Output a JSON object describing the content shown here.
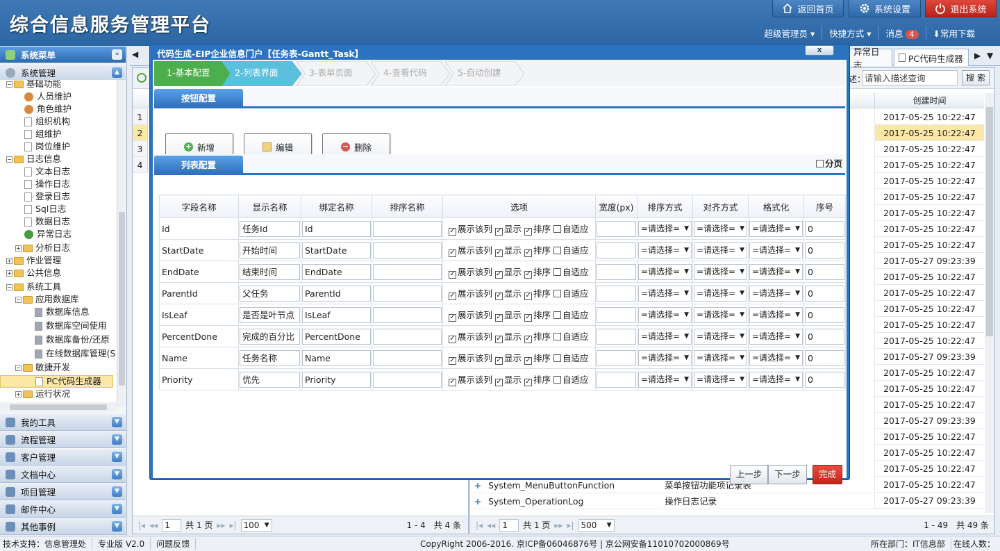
{
  "header": {
    "title": "综合信息服务管理平台",
    "top_buttons": {
      "home": "返回首页",
      "settings": "系统设置",
      "logout": "退出系统"
    },
    "user_bar": {
      "user": "超级管理员",
      "shortcuts": "快捷方式",
      "messages": "消息",
      "message_count": "4",
      "downloads": "常用下载"
    }
  },
  "sidebar": {
    "title": "系统菜单",
    "section": "系统管理",
    "tree": [
      {
        "label": "基础功能",
        "type": "folder"
      },
      {
        "label": "人员维护",
        "type": "user"
      },
      {
        "label": "角色维护",
        "type": "user"
      },
      {
        "label": "组织机构",
        "type": "doc"
      },
      {
        "label": "组维护",
        "type": "doc"
      },
      {
        "label": "岗位维护",
        "type": "doc"
      },
      {
        "label": "日志信息",
        "type": "folder"
      },
      {
        "label": "文本日志",
        "type": "doc"
      },
      {
        "label": "操作日志",
        "type": "doc"
      },
      {
        "label": "登录日志",
        "type": "doc"
      },
      {
        "label": "Sql日志",
        "type": "doc"
      },
      {
        "label": "数据日志",
        "type": "doc"
      },
      {
        "label": "异常日志",
        "type": "bug"
      },
      {
        "label": "分析日志",
        "type": "folder"
      },
      {
        "label": "作业管理",
        "type": "folder"
      },
      {
        "label": "公共信息",
        "type": "folder"
      },
      {
        "label": "系统工具",
        "type": "folder"
      },
      {
        "label": "应用数据库",
        "type": "folder"
      },
      {
        "label": "数据库信息",
        "type": "db"
      },
      {
        "label": "数据库空间使用",
        "type": "db"
      },
      {
        "label": "数据库备份/还原",
        "type": "db"
      },
      {
        "label": "在线数据库管理(S",
        "type": "db"
      },
      {
        "label": "敏捷开发",
        "type": "folder"
      },
      {
        "label": "PC代码生成器",
        "type": "doc"
      },
      {
        "label": "运行状况",
        "type": "folder"
      }
    ],
    "panels": [
      "我的工具",
      "流程管理",
      "客户管理",
      "文档中心",
      "项目管理",
      "邮件中心",
      "其他事例"
    ]
  },
  "background": {
    "tabs": [
      "异常日志",
      "PC代码生成器"
    ],
    "search_label": "述：",
    "search_placeholder": "请输入描述查询",
    "search_button": "搜 索",
    "left_rows": [
      "1",
      "2",
      "3",
      "4"
    ],
    "created_header": "创建时间",
    "created_times": [
      "2017-05-25 10:22:47",
      "2017-05-25 10:22:47",
      "2017-05-25 10:22:47",
      "2017-05-25 10:22:47",
      "2017-05-25 10:22:47",
      "2017-05-25 10:22:47",
      "2017-05-25 10:22:47",
      "2017-05-25 10:22:47",
      "2017-05-25 10:22:47",
      "2017-05-27 09:23:39",
      "2017-05-25 10:22:47",
      "2017-05-25 10:22:47",
      "2017-05-25 10:22:47",
      "2017-05-25 10:22:47",
      "2017-05-25 10:22:47",
      "2017-05-27 09:23:39",
      "2017-05-25 10:22:47",
      "2017-05-25 10:22:47",
      "2017-05-25 10:22:47",
      "2017-05-27 09:23:39",
      "2017-05-25 10:22:47",
      "2017-05-25 10:22:47",
      "2017-05-25 10:22:47",
      "2017-05-25 10:22:47",
      "2017-05-27 09:23:39"
    ],
    "bottom_rows": [
      {
        "name": "System_MenuButtonFunction",
        "desc": "菜单按钮功能项记录表"
      },
      {
        "name": "System_OperationLog",
        "desc": "操作日志记录"
      }
    ],
    "left_pager": {
      "page": "1",
      "total_pages": "共 1 页",
      "size": "100",
      "info": "1 - 4　共 4 条"
    },
    "right_pager": {
      "page": "1",
      "total_pages": "共 1 页",
      "size": "500",
      "info": "1 - 49　共 49 条"
    }
  },
  "modal": {
    "title": "代码生成-EIP企业信息门户【任务表-Gantt_Task】",
    "close": "x",
    "steps": [
      "1-基本配置",
      "2-列表界面",
      "3-表单页面",
      "4-查看代码",
      "5-自动创建"
    ],
    "button_section": "按钮配置",
    "buttons": {
      "add": "新增",
      "edit": "编辑",
      "delete": "删除"
    },
    "list_section": "列表配置",
    "paging_label": "分页",
    "columns": [
      "字段名称",
      "显示名称",
      "绑定名称",
      "排序名称",
      "选项",
      "宽度(px)",
      "排序方式",
      "对齐方式",
      "格式化",
      "序号"
    ],
    "options": [
      "展示该列",
      "显示",
      "排序",
      "自适应"
    ],
    "select_placeholder": "=请选择=",
    "rows": [
      {
        "field": "Id",
        "display": "任务Id",
        "bind": "Id",
        "order": "0"
      },
      {
        "field": "StartDate",
        "display": "开始时间",
        "bind": "StartDate",
        "order": "0"
      },
      {
        "field": "EndDate",
        "display": "结束时间",
        "bind": "EndDate",
        "order": "0"
      },
      {
        "field": "ParentId",
        "display": "父任务",
        "bind": "ParentId",
        "order": "0"
      },
      {
        "field": "IsLeaf",
        "display": "是否是叶节点",
        "bind": "IsLeaf",
        "order": "0"
      },
      {
        "field": "PercentDone",
        "display": "完成的百分比",
        "bind": "PercentDone",
        "order": "0"
      },
      {
        "field": "Name",
        "display": "任务名称",
        "bind": "Name",
        "order": "0"
      },
      {
        "field": "Priority",
        "display": "优先",
        "bind": "Priority",
        "order": "0"
      }
    ],
    "nav": {
      "prev": "上一步",
      "next": "下一步",
      "finish": "完成"
    }
  },
  "footer": {
    "support": "技术支持：信息管理处",
    "edition": "专业版 V2.0",
    "feedback": "问题反馈",
    "copyright": "CopyRight 2006-2016. 京ICP备06046876号 | 京公网安备11010702000869号",
    "dept": "所在部门：IT信息部",
    "online": "在线人数："
  },
  "colors": {
    "header_blue": "#2c65a3",
    "accent_blue": "#2a73c2",
    "finish_red": "#c1271a",
    "selected_row": "#fbe7a6"
  }
}
